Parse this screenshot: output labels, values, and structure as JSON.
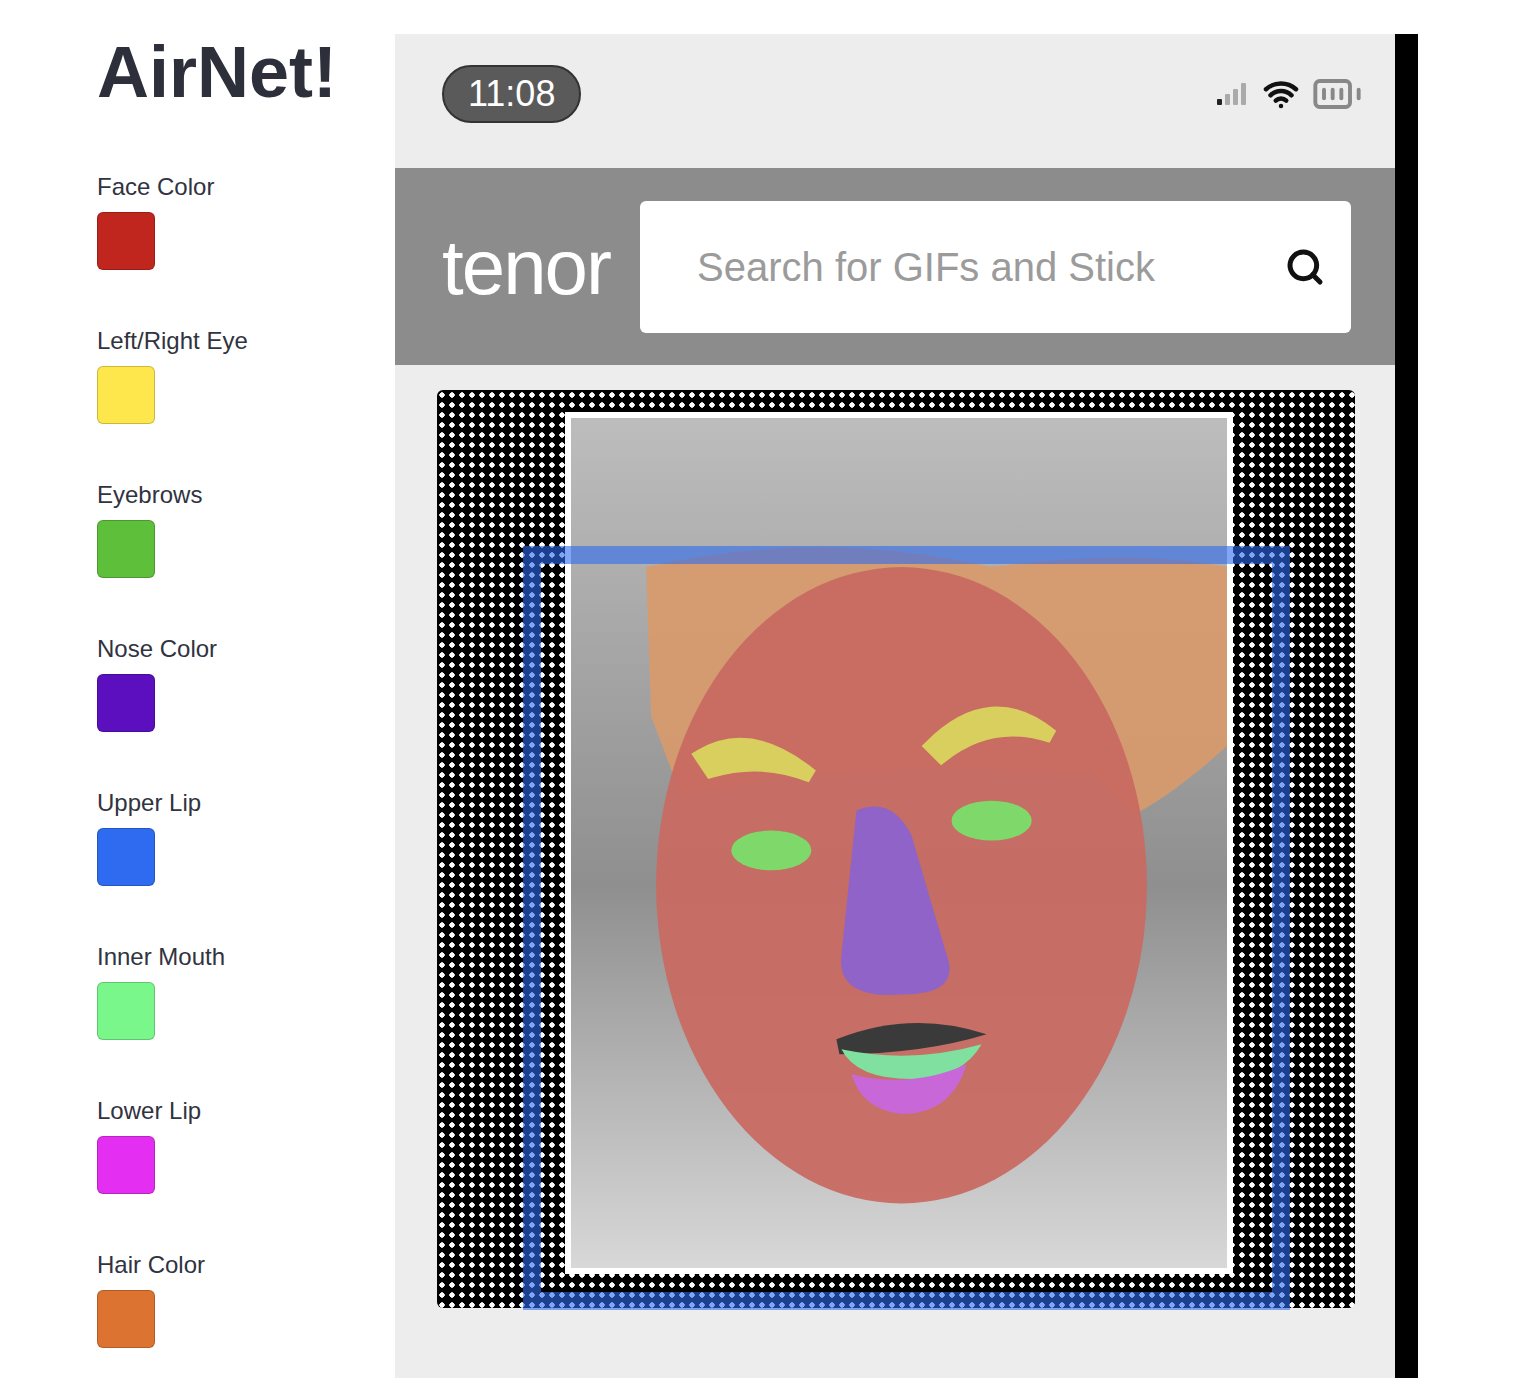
{
  "app": {
    "title": "AirNet!"
  },
  "legend": [
    {
      "label": "Face Color",
      "color": "#c0261e"
    },
    {
      "label": "Left/Right Eye",
      "color": "#fde74c"
    },
    {
      "label": "Eyebrows",
      "color": "#5dbf3a"
    },
    {
      "label": "Nose Color",
      "color": "#5b0fbf"
    },
    {
      "label": "Upper Lip",
      "color": "#2f6bf0"
    },
    {
      "label": "Inner Mouth",
      "color": "#79f78a"
    },
    {
      "label": "Lower Lip",
      "color": "#e42ef2"
    },
    {
      "label": "Hair Color",
      "color": "#dc7331"
    }
  ],
  "phone": {
    "time": "11:08",
    "logo": "tenor",
    "search": {
      "placeholder": "Search for GIFs and Stick"
    }
  }
}
